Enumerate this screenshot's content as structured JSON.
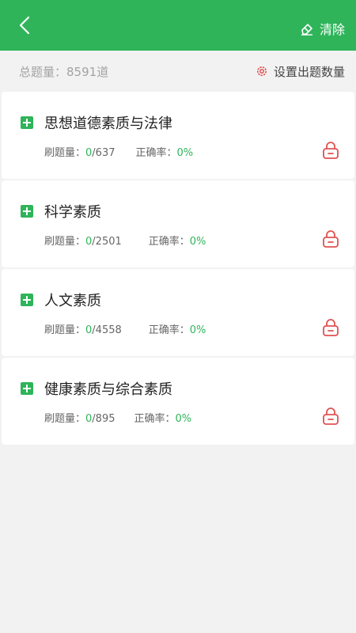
{
  "header": {
    "title": "",
    "clear_label": "清除",
    "colors": {
      "accent": "#2fb45a",
      "lock": "#e05252"
    }
  },
  "summary": {
    "total_label": "总题量：",
    "total_value": "8591道",
    "settings_label": "设置出题数量"
  },
  "categories": [
    {
      "title": "思想道德素质与法律",
      "done": "0",
      "total": "/637",
      "accuracy": "0%"
    },
    {
      "title": "科学素质",
      "done": "0",
      "total": "/2501",
      "accuracy": "0%"
    },
    {
      "title": "人文素质",
      "done": "0",
      "total": "/4558",
      "accuracy": "0%"
    },
    {
      "title": "健康素质与综合素质",
      "done": "0",
      "total": "/895",
      "accuracy": "0%"
    }
  ],
  "labels": {
    "practice": "刷题量：",
    "accuracy": "正确率："
  }
}
